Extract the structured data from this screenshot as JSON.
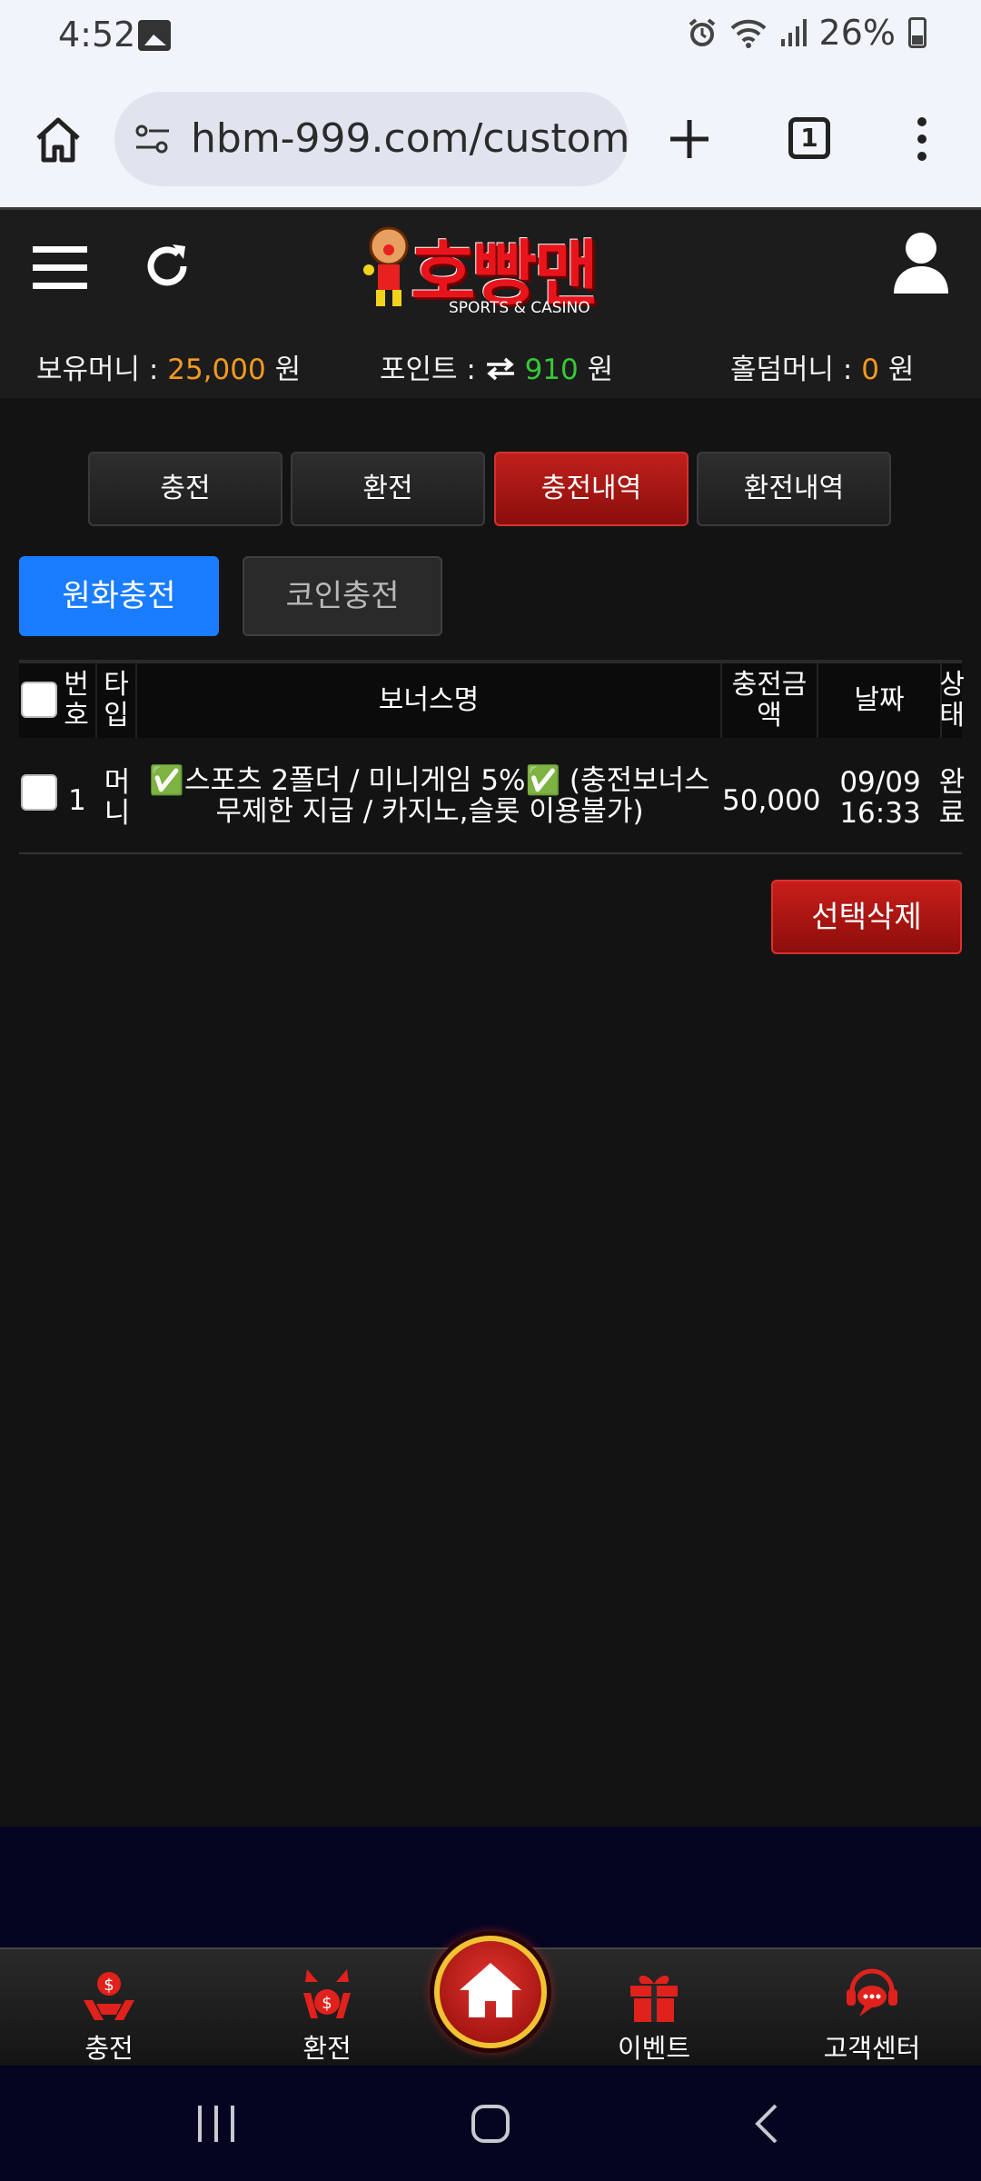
{
  "status_bar": {
    "time": "4:52",
    "battery": "26%"
  },
  "browser": {
    "url": "hbm-999.com/custom",
    "tab_count": "1"
  },
  "site": {
    "logo_text": "호빵맨",
    "logo_sub": "SPORTS & CASINO",
    "balances": {
      "money_label": "보유머니 : ",
      "money_value": "25,000",
      "money_unit": " 원",
      "point_label": "포인트 : ",
      "point_value": "910",
      "point_unit": " 원",
      "holdem_label": "홀덤머니 : ",
      "holdem_value": "0",
      "holdem_unit": " 원"
    }
  },
  "tabs": [
    "충전",
    "환전",
    "충전내역",
    "환전내역"
  ],
  "active_tab": "충전내역",
  "subtabs": {
    "krw": "원화충전",
    "coin": "코인충전"
  },
  "table": {
    "headers": {
      "no": "번\n호",
      "type": "타\n입",
      "bonus": "보너스명",
      "amount": "충전금\n액",
      "date": "날짜",
      "status": "상\n태"
    },
    "rows": [
      {
        "no": "1",
        "type": "머\n니",
        "bonus": "✅스포츠 2폴더 / 미니게임 5%✅ (충전보너스 무제한 지급 / 카지노,슬롯 이용불가)",
        "amount": "50,000",
        "date": "09/09\n16:33",
        "status": "완\n료"
      }
    ]
  },
  "delete_label": "선택삭제",
  "bottom_nav": {
    "charge": "충전",
    "exchange": "환전",
    "event": "이벤트",
    "support": "고객센터"
  },
  "colors": {
    "accent_red": "#c0201c",
    "accent_blue": "#1a7cff",
    "money_orange": "#f29a20",
    "point_green": "#36c836"
  }
}
